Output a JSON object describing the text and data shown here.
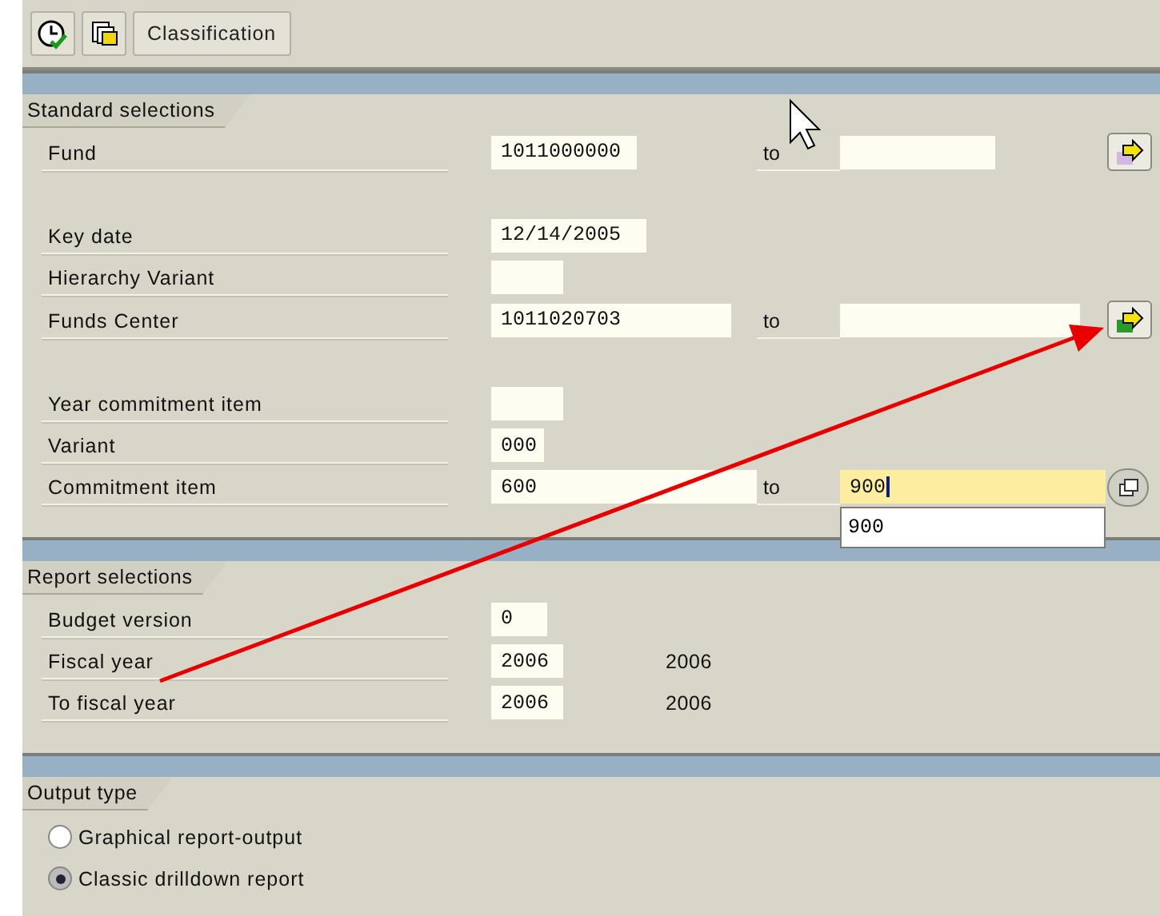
{
  "toolbar": {
    "buttons": [
      {
        "kind": "execute"
      },
      {
        "kind": "copy"
      },
      {
        "kind": "text",
        "label": "Classification"
      }
    ]
  },
  "sections": [
    {
      "title": "Standard selections",
      "groups": [
        {
          "rows": [
            {
              "label": "Fund",
              "low": {
                "value": "1011000000"
              },
              "high": {
                "label": "to",
                "focused": false
              },
              "button": {
                "kind": "range_empty"
              }
            }
          ]
        },
        {
          "rows": [
            {
              "label": "Key date",
              "low": {
                "value": "12/14/2005"
              }
            },
            {
              "label": "Hierarchy Variant",
              "low": {}
            },
            {
              "label": "Funds Center",
              "low": {
                "value": "1011020703"
              },
              "high": {
                "label": "to",
                "focused": false
              },
              "button": {
                "kind": "range_filled"
              }
            }
          ]
        },
        {
          "rows": [
            {
              "label": "Year commitment item",
              "low": {}
            },
            {
              "label": "Variant",
              "low": {
                "value": "000"
              }
            },
            {
              "label": "Commitment item",
              "low": {
                "value": "600"
              },
              "high": {
                "label": "to",
                "value": "900",
                "focused": true,
                "suggestions": [
                  "900"
                ]
              },
              "button": {
                "kind": "value_help"
              }
            }
          ]
        }
      ]
    },
    {
      "title": "Report selections",
      "groups": [
        {
          "rows": [
            {
              "label": "Budget version",
              "low": {
                "value": "0"
              }
            },
            {
              "label": "Fiscal year",
              "low": {
                "value": "2006"
              },
              "text": "2006"
            },
            {
              "label": "To fiscal year",
              "low": {
                "value": "2006"
              },
              "text": "2006"
            }
          ]
        }
      ]
    },
    {
      "title": "Output type",
      "options": [
        {
          "label": "Graphical report-output",
          "selected": false
        },
        {
          "label": "Classic drilldown report",
          "selected": true
        }
      ]
    }
  ]
}
